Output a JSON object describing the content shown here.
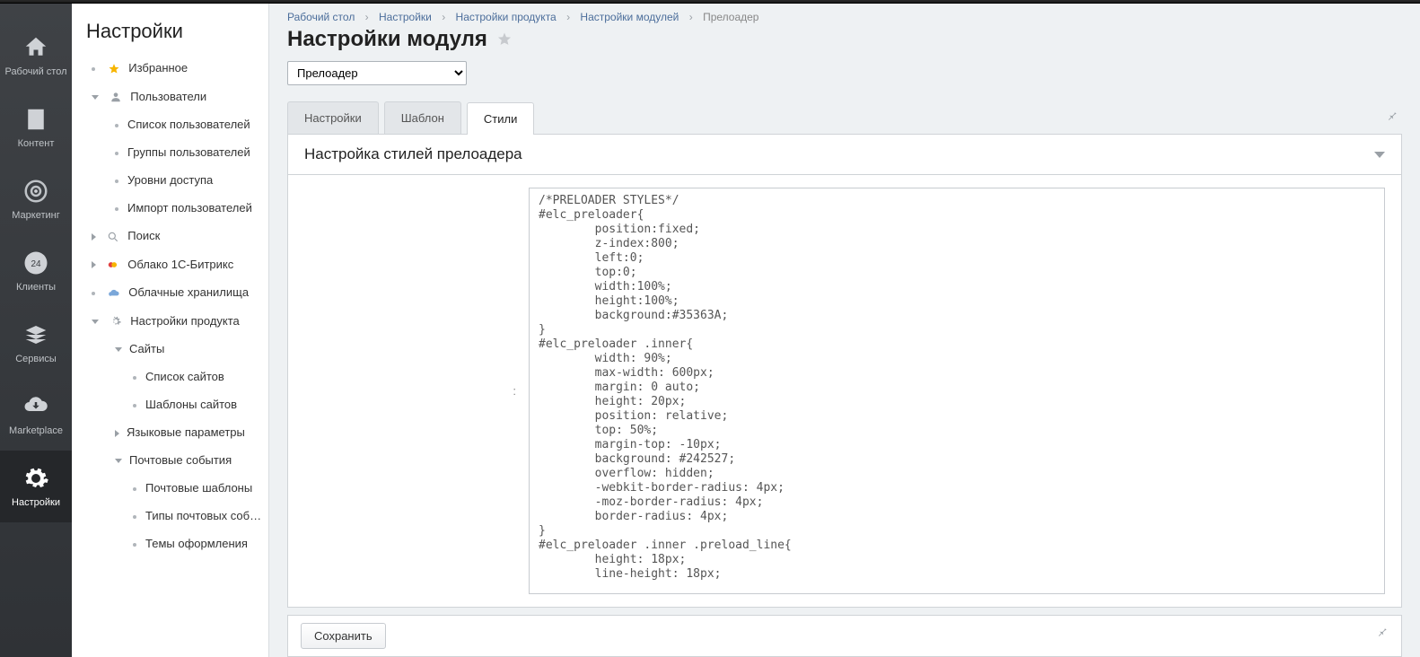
{
  "rail": [
    {
      "label": "Рабочий стол"
    },
    {
      "label": "Контент"
    },
    {
      "label": "Маркетинг"
    },
    {
      "label": "Клиенты"
    },
    {
      "label": "Сервисы"
    },
    {
      "label": "Marketplace"
    },
    {
      "label": "Настройки"
    }
  ],
  "sidebar": {
    "title": "Настройки",
    "items": {
      "favorites": "Избранное",
      "users": "Пользователи",
      "users_list": "Список пользователей",
      "users_groups": "Группы пользователей",
      "users_access": "Уровни доступа",
      "users_import": "Импорт пользователей",
      "search": "Поиск",
      "cloud_1c": "Облако 1С-Битрикс",
      "cloud_storage": "Облачные хранилища",
      "product_settings": "Настройки продукта",
      "sites": "Сайты",
      "sites_list": "Список сайтов",
      "sites_templates": "Шаблоны сайтов",
      "lang_params": "Языковые параметры",
      "mail_events": "Почтовые события",
      "mail_templates": "Почтовые шаблоны",
      "mail_event_types": "Типы почтовых событий",
      "mail_themes": "Темы оформления"
    }
  },
  "breadcrumb": {
    "items": [
      "Рабочий стол",
      "Настройки",
      "Настройки продукта",
      "Настройки модулей"
    ],
    "current": "Прелоадер"
  },
  "page_title": "Настройки модуля",
  "module_select": {
    "value": "Прелоадер"
  },
  "tabs": {
    "settings": "Настройки",
    "template": "Шаблон",
    "styles": "Стили"
  },
  "panel_title": "Настройка стилей прелоадера",
  "code_colon": ":",
  "code_value": "/*PRELOADER STYLES*/\n#elc_preloader{\n        position:fixed;\n        z-index:800;\n        left:0;\n        top:0;\n        width:100%;\n        height:100%;\n        background:#35363A;\n}\n#elc_preloader .inner{\n        width: 90%;\n        max-width: 600px;\n        margin: 0 auto;\n        height: 20px;\n        position: relative;\n        top: 50%;\n        margin-top: -10px;\n        background: #242527;\n        overflow: hidden;\n        -webkit-border-radius: 4px;\n        -moz-border-radius: 4px;\n        border-radius: 4px;\n}\n#elc_preloader .inner .preload_line{\n        height: 18px;\n        line-height: 18px;",
  "save_button": "Сохранить"
}
